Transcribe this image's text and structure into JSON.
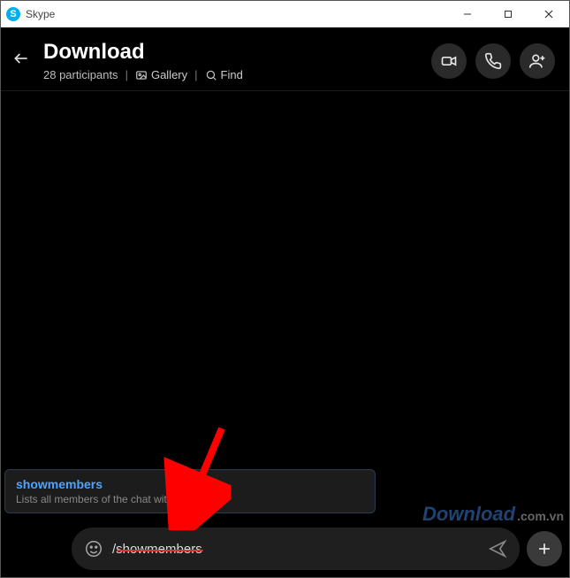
{
  "window": {
    "title": "Skype"
  },
  "header": {
    "title": "Download",
    "participants": "28 participants",
    "gallery": "Gallery",
    "find": "Find"
  },
  "suggestion": {
    "command": "showmembers",
    "description": "Lists all members of the chat with their role"
  },
  "composer": {
    "value": "/showmembers"
  },
  "watermark": {
    "brand": "Download",
    "suffix": ".com.vn"
  }
}
